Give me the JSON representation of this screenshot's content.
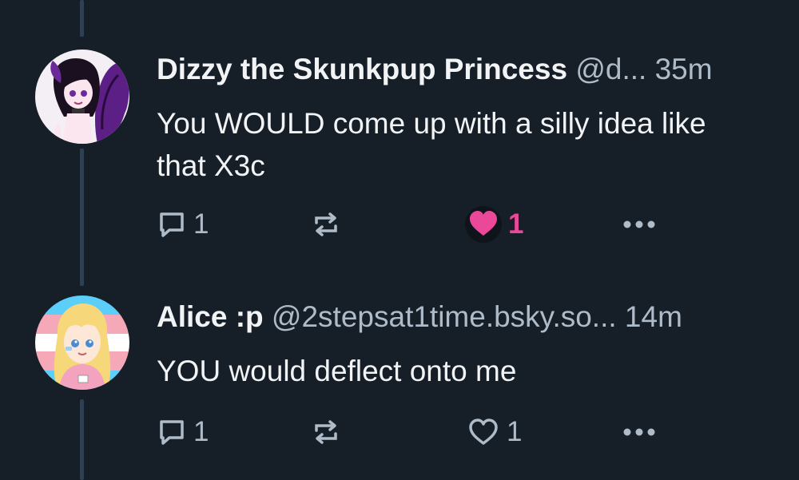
{
  "colors": {
    "background": "#161e27",
    "thread_line": "#2e4052",
    "text_primary": "#f1f3f5",
    "text_secondary": "#aebbc9",
    "like_active": "#ec4899"
  },
  "posts": [
    {
      "display_name": "Dizzy the Skunkpup Princess",
      "handle": "@d...",
      "timestamp": "35m",
      "text": "You WOULD come up with a silly idea like that X3c",
      "avatar_icon": "purple-skunk-character-avatar",
      "reply_count": "1",
      "like_count": "1",
      "liked": true
    },
    {
      "display_name": "Alice :p",
      "handle": "@2stepsat1time.bsky.so...",
      "timestamp": "14m",
      "text": "YOU would deflect onto me",
      "avatar_icon": "blonde-girl-trans-flag-avatar",
      "reply_count": "1",
      "like_count": "1",
      "liked": false
    }
  ]
}
